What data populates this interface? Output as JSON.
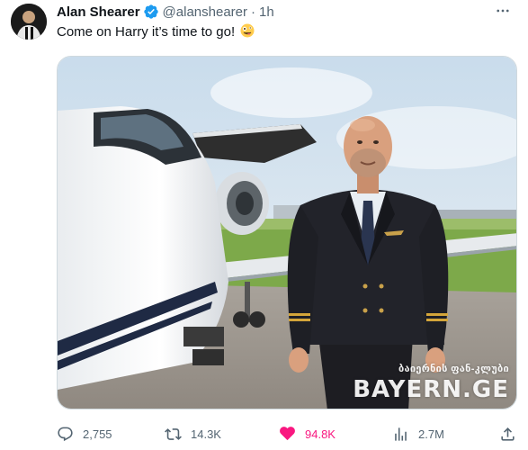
{
  "author": {
    "name": "Alan Shearer",
    "handle": "@alanshearer",
    "separator": "·",
    "time": "1h",
    "verified": true
  },
  "tweet": {
    "text": "Come on Harry it’s time to go!",
    "emoji": "zany-face"
  },
  "media": {
    "watermark_top": "ბაიერნის ფან-კლუბი",
    "watermark_main": "BAYERN.GE"
  },
  "actions": {
    "replies": "2,755",
    "reposts": "14.3K",
    "likes": "94.8K",
    "views": "2.7M"
  },
  "colors": {
    "text": "#0f1419",
    "secondary": "#536471",
    "like": "#f91880",
    "verified": "#1d9bf0",
    "border": "#cfd9de"
  },
  "icons": [
    "more-icon",
    "verified-badge-icon",
    "reply-icon",
    "repost-icon",
    "like-icon",
    "views-icon",
    "share-icon"
  ]
}
